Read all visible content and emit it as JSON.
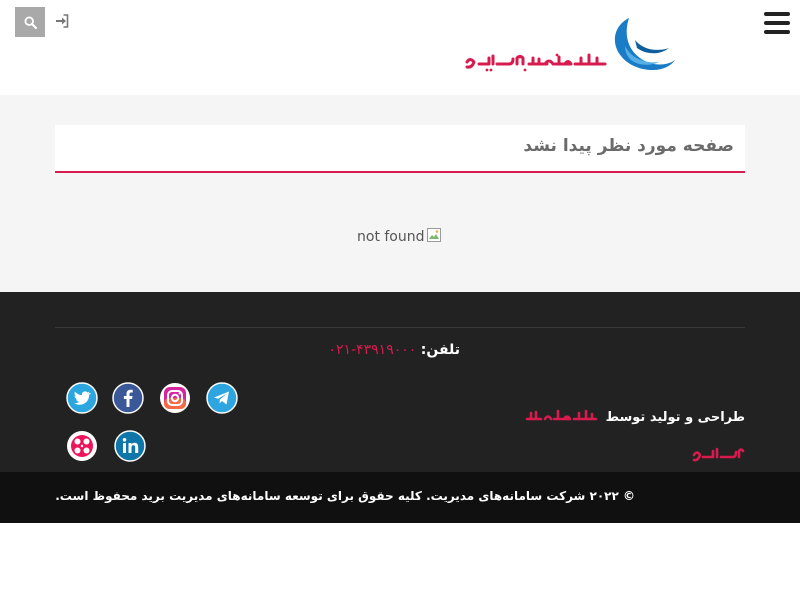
{
  "header": {
    "search_icon": "search-icon",
    "login_icon": "sign-in-icon",
    "menu_icon": "hamburger-menu-icon",
    "logo_text": "سامانه‌های مدیریت",
    "colors": {
      "brand_blue": "#1a7cc6",
      "brand_red": "#d81b4e"
    }
  },
  "main": {
    "page_title": "صفحه مورد نظر پیدا نشد",
    "image_alt": "not found"
  },
  "footer": {
    "phone_label": "تلفن:",
    "phone_number": "۰۲۱-۴۳۹۱۹۰۰۰",
    "social_icons": [
      "telegram-icon",
      "instagram-icon",
      "facebook-icon",
      "twitter-icon",
      "linkedin-icon",
      "aparat-icon"
    ],
    "credit_text": "طراحی و تولید توسط",
    "credit_logo_text": "سامانه‌های مدیریت",
    "copyright": "© ۲۰۲۲ شرکت سامانه‌های مدیریت. کلیه حقوق برای توسعه سامانه‌های مدیریت برید محفوظ است."
  }
}
